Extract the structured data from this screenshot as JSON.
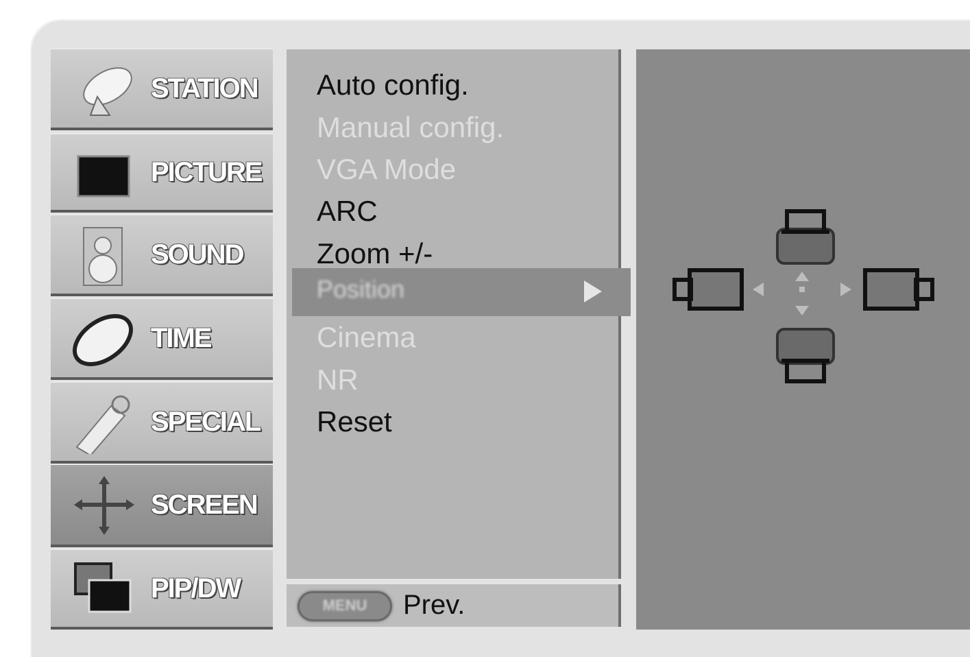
{
  "categories": [
    {
      "label": "STATION",
      "icon": "satellite-dish-icon"
    },
    {
      "label": "PICTURE",
      "icon": "picture-icon"
    },
    {
      "label": "SOUND",
      "icon": "speaker-icon"
    },
    {
      "label": "TIME",
      "icon": "clock-icon"
    },
    {
      "label": "SPECIAL",
      "icon": "special-icon"
    },
    {
      "label": "SCREEN",
      "icon": "screen-move-icon",
      "active": true
    },
    {
      "label": "PIP/DW",
      "icon": "pip-icon"
    }
  ],
  "menu": {
    "items": [
      {
        "label": "Auto config.",
        "enabled": true
      },
      {
        "label": "Manual config.",
        "enabled": false
      },
      {
        "label": "VGA Mode",
        "enabled": false
      },
      {
        "label": "ARC",
        "enabled": true
      },
      {
        "label": "Zoom +/-",
        "enabled": true
      },
      {
        "label": "Position",
        "enabled": true,
        "selected": true
      },
      {
        "label": "Cinema",
        "enabled": false
      },
      {
        "label": "NR",
        "enabled": false
      },
      {
        "label": "Reset",
        "enabled": true
      }
    ]
  },
  "footer": {
    "menu_key": "MENU",
    "prev_label": "Prev."
  },
  "preview": {
    "icon": "position-adjust-icon"
  },
  "colors": {
    "panel_light": "#b5b5b5",
    "panel_dark": "#8a8a8a",
    "highlight": "#8c8c8c",
    "text": "#111111",
    "disabled_text": "#dedede"
  }
}
